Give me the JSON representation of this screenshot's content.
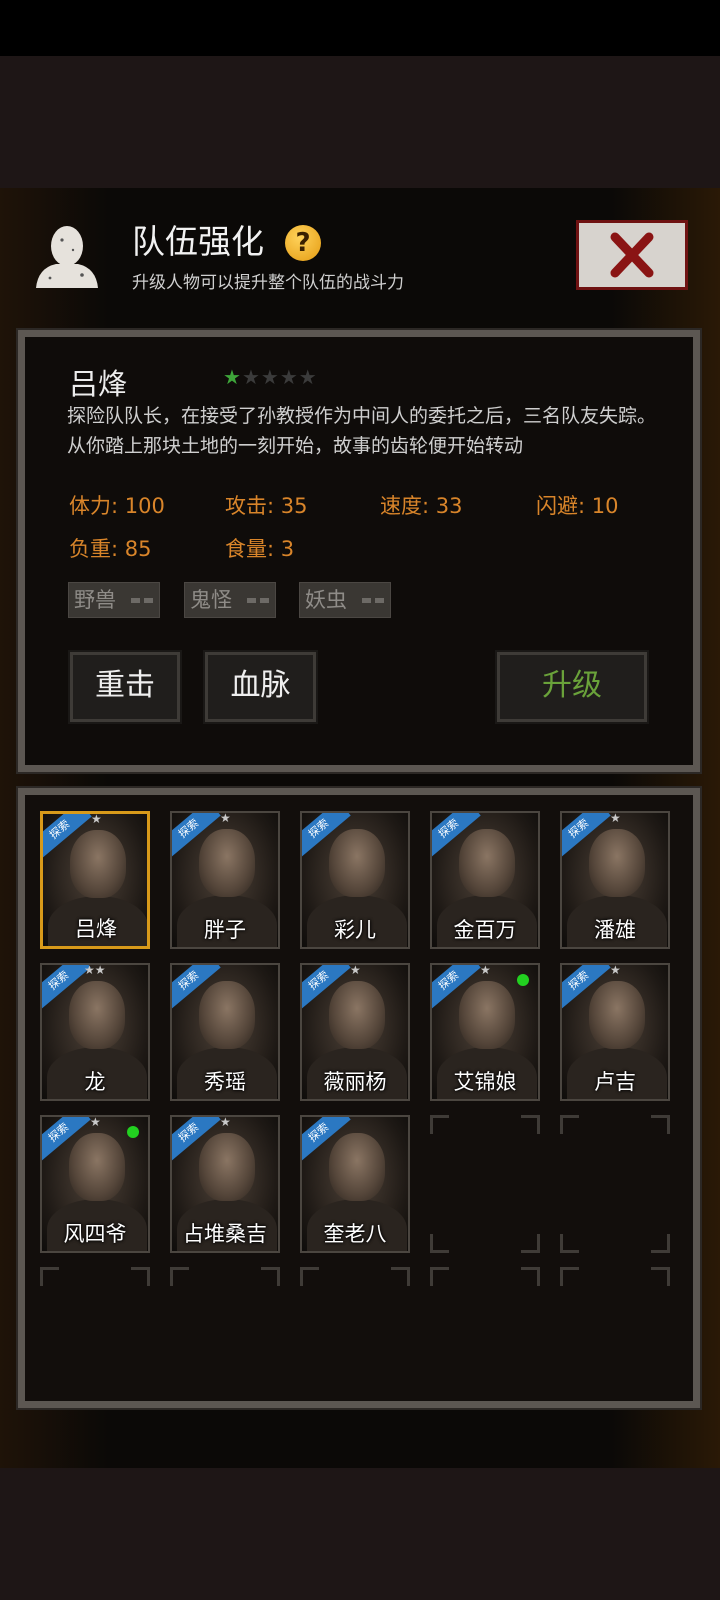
{
  "header": {
    "title": "队伍强化",
    "subtitle": "升级人物可以提升整个队伍的战斗力",
    "help_icon": "question-mark-icon",
    "close_icon": "close-x-icon"
  },
  "character": {
    "name": "吕烽",
    "stars_total": 5,
    "stars_filled": 1,
    "description": "探险队队长，在接受了孙教授作为中间人的委托之后，三名队友失踪。从你踏上那块土地的一刻开始，故事的齿轮便开始转动",
    "stats": [
      {
        "label": "体力: 100"
      },
      {
        "label": "攻击: 35"
      },
      {
        "label": "速度: 33"
      },
      {
        "label": "闪避: 10"
      },
      {
        "label": "负重: 85"
      },
      {
        "label": "食量: 3"
      }
    ],
    "tags": [
      "野兽",
      "鬼怪",
      "妖虫"
    ]
  },
  "actions": {
    "heavy_strike": "重击",
    "bloodline": "血脉",
    "upgrade": "升级"
  },
  "roster": [
    {
      "name": "吕烽",
      "badge": "探索",
      "stars": "★",
      "selected": true,
      "online": false
    },
    {
      "name": "胖子",
      "badge": "探索",
      "stars": "★",
      "selected": false,
      "online": false
    },
    {
      "name": "彩儿",
      "badge": "探索",
      "stars": "",
      "selected": false,
      "online": false
    },
    {
      "name": "金百万",
      "badge": "探索",
      "stars": "",
      "selected": false,
      "online": false
    },
    {
      "name": "潘雄",
      "badge": "探索",
      "stars": "★",
      "selected": false,
      "online": false
    },
    {
      "name": "龙",
      "badge": "探索",
      "stars": "★★",
      "selected": false,
      "online": false
    },
    {
      "name": "秀瑶",
      "badge": "探索",
      "stars": "",
      "selected": false,
      "online": false
    },
    {
      "name": "薇丽杨",
      "badge": "探索",
      "stars": "★",
      "selected": false,
      "online": false
    },
    {
      "name": "艾锦娘",
      "badge": "探索",
      "stars": "★",
      "selected": false,
      "online": true
    },
    {
      "name": "卢吉",
      "badge": "探索",
      "stars": "★",
      "selected": false,
      "online": false
    },
    {
      "name": "风四爷",
      "badge": "探索",
      "stars": "★",
      "selected": false,
      "online": true
    },
    {
      "name": "占堆桑吉",
      "badge": "探索",
      "stars": "★",
      "selected": false,
      "online": false
    },
    {
      "name": "奎老八",
      "badge": "探索",
      "stars": "",
      "selected": false,
      "online": false
    }
  ],
  "colors": {
    "stat_text": "#d9852a",
    "star_on": "#3ea63a",
    "upgrade_text": "#6aa23a",
    "selected_border": "#d89a1a",
    "badge_blue": "#2b78c2",
    "online_green": "#22d020"
  }
}
